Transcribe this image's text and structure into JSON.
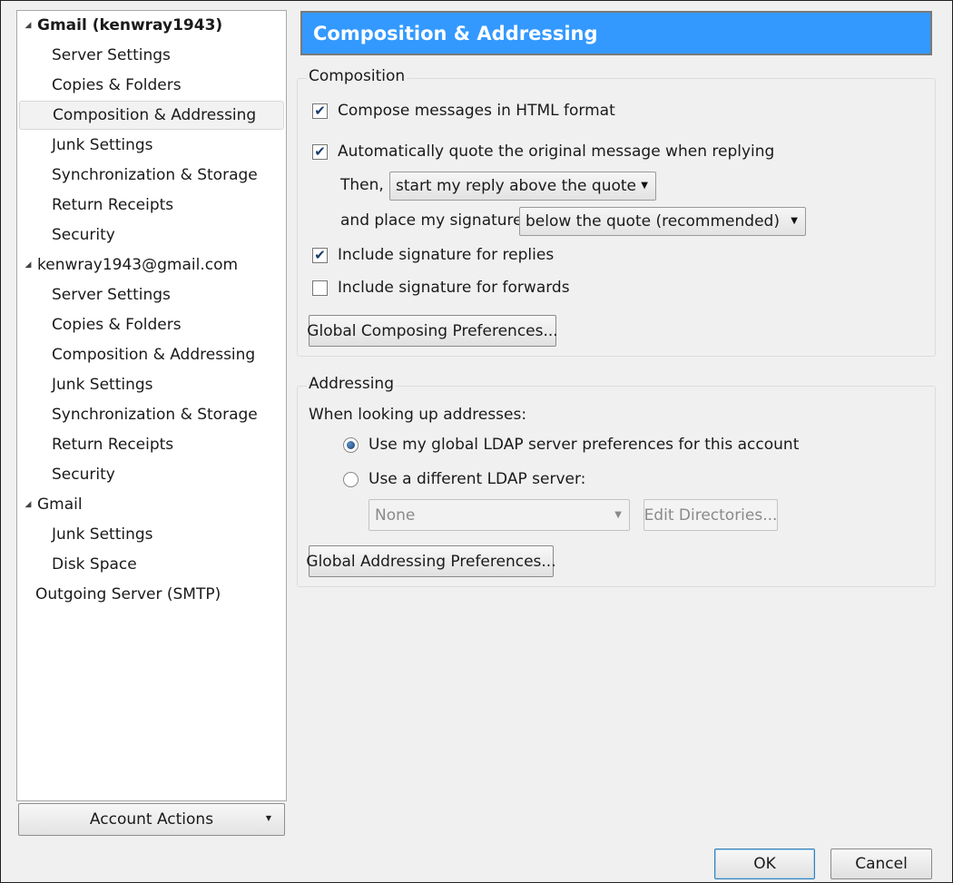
{
  "tree": {
    "items": [
      {
        "label": "Gmail (kenwray1943)",
        "type": "account",
        "bold": true,
        "expanded": true
      },
      {
        "label": "Server Settings",
        "type": "child"
      },
      {
        "label": "Copies & Folders",
        "type": "child"
      },
      {
        "label": "Composition & Addressing",
        "type": "child",
        "selected": true
      },
      {
        "label": "Junk Settings",
        "type": "child"
      },
      {
        "label": "Synchronization & Storage",
        "type": "child"
      },
      {
        "label": "Return Receipts",
        "type": "child"
      },
      {
        "label": "Security",
        "type": "child"
      },
      {
        "label": "kenwray1943@gmail.com",
        "type": "account",
        "expanded": true
      },
      {
        "label": "Server Settings",
        "type": "child"
      },
      {
        "label": "Copies & Folders",
        "type": "child"
      },
      {
        "label": "Composition & Addressing",
        "type": "child"
      },
      {
        "label": "Junk Settings",
        "type": "child"
      },
      {
        "label": "Synchronization & Storage",
        "type": "child"
      },
      {
        "label": "Return Receipts",
        "type": "child"
      },
      {
        "label": "Security",
        "type": "child"
      },
      {
        "label": "Gmail",
        "type": "account",
        "expanded": true
      },
      {
        "label": "Junk Settings",
        "type": "child"
      },
      {
        "label": "Disk Space",
        "type": "child"
      },
      {
        "label": "Outgoing Server (SMTP)",
        "type": "noicon"
      }
    ],
    "account_actions_label": "Account Actions"
  },
  "header": {
    "title": "Composition & Addressing"
  },
  "composition": {
    "legend": "Composition",
    "html_format": {
      "label": "Compose messages in HTML format",
      "checked": true
    },
    "auto_quote": {
      "label": "Automatically quote the original message when replying",
      "checked": true
    },
    "then_label": "Then,",
    "reply_position": "start my reply above the quote",
    "signature_label": "and place my signature",
    "signature_position": "below the quote (recommended)",
    "sig_replies": {
      "label": "Include signature for replies",
      "checked": true
    },
    "sig_forwards": {
      "label": "Include signature for forwards",
      "checked": false
    },
    "global_button": "Global Composing Preferences..."
  },
  "addressing": {
    "legend": "Addressing",
    "lookup_label": "When looking up addresses:",
    "use_global": {
      "label": "Use my global LDAP server preferences for this account",
      "checked": true
    },
    "use_different": {
      "label": "Use a different LDAP server:",
      "checked": false
    },
    "ldap_server": "None",
    "edit_directories": "Edit Directories...",
    "global_button": "Global Addressing Preferences..."
  },
  "footer": {
    "ok": "OK",
    "cancel": "Cancel"
  },
  "colors": {
    "header_bg": "#3399ff",
    "selection_bg": "#f2f2f2"
  }
}
